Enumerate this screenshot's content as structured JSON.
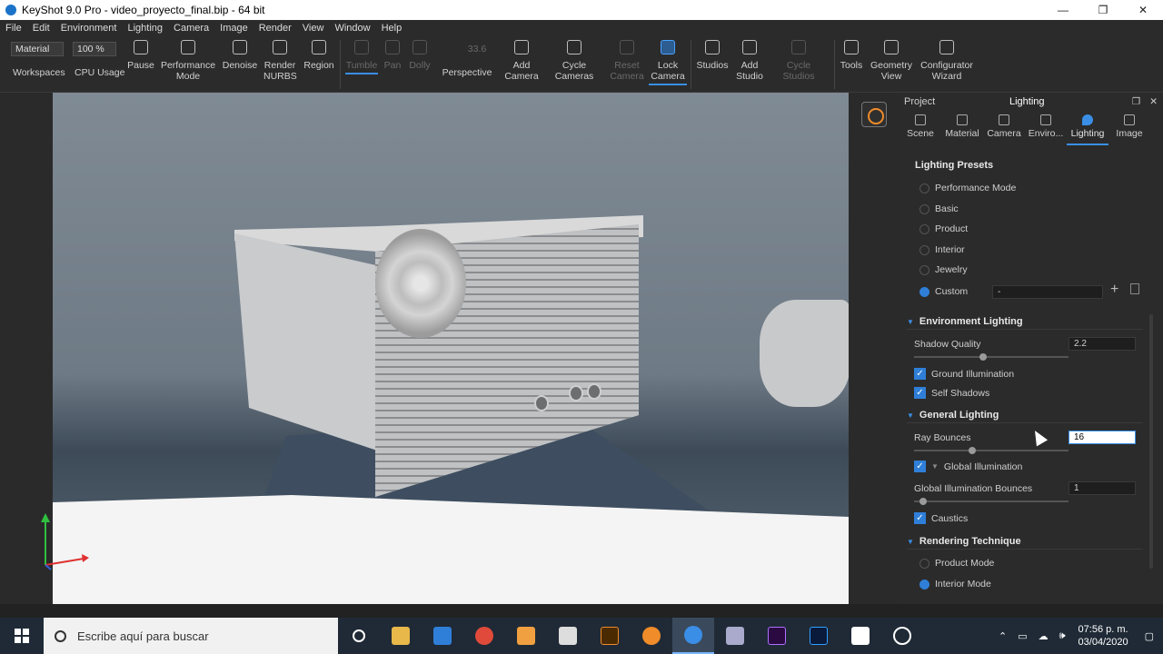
{
  "window": {
    "title": "KeyShot 9.0 Pro  -  video_proyecto_final.bip  -  64 bit",
    "minimize": "—",
    "restore": "❐",
    "close": "✕"
  },
  "menu": [
    "File",
    "Edit",
    "Environment",
    "Lighting",
    "Camera",
    "Image",
    "Render",
    "View",
    "Window",
    "Help"
  ],
  "toolbar": {
    "material_select": "Material",
    "zoom_select": "100 %",
    "value_field": "33.6",
    "workspaces": "Workspaces",
    "cpu_usage": "CPU Usage",
    "pause": "Pause",
    "performance_mode": "Performance Mode",
    "denoise": "Denoise",
    "render_nurbs": "Render NURBS",
    "region": "Region",
    "tumble": "Tumble",
    "pan": "Pan",
    "dolly": "Dolly",
    "perspective": "Perspective",
    "add_camera": "Add Camera",
    "cycle_cameras": "Cycle Cameras",
    "reset_camera": "Reset Camera",
    "lock_camera": "Lock Camera",
    "studios": "Studios",
    "add_studio": "Add Studio",
    "cycle_studios": "Cycle Studios",
    "tools": "Tools",
    "geometry_view": "Geometry View",
    "configurator_wizard": "Configurator Wizard"
  },
  "panel": {
    "project_label": "Project",
    "title": "Lighting",
    "tabs": [
      "Scene",
      "Material",
      "Camera",
      "Enviro...",
      "Lighting",
      "Image"
    ],
    "presets_title": "Lighting Presets",
    "presets": [
      "Performance Mode",
      "Basic",
      "Product",
      "Interior",
      "Jewelry",
      "Custom"
    ],
    "custom_value": "-",
    "environment_lighting": "Environment Lighting",
    "shadow_quality_label": "Shadow Quality",
    "shadow_quality_value": "2.2",
    "ground_illumination": "Ground Illumination",
    "self_shadows": "Self Shadows",
    "general_lighting": "General Lighting",
    "ray_bounces_label": "Ray Bounces",
    "ray_bounces_value": "16",
    "global_illumination": "Global Illumination",
    "gi_bounces_label": "Global Illumination Bounces",
    "gi_bounces_value": "1",
    "caustics": "Caustics",
    "rendering_technique": "Rendering Technique",
    "product_mode": "Product Mode",
    "interior_mode": "Interior Mode"
  },
  "taskbar": {
    "search_placeholder": "Escribe aquí para buscar",
    "time": "07:56 p. m.",
    "date": "03/04/2020"
  }
}
